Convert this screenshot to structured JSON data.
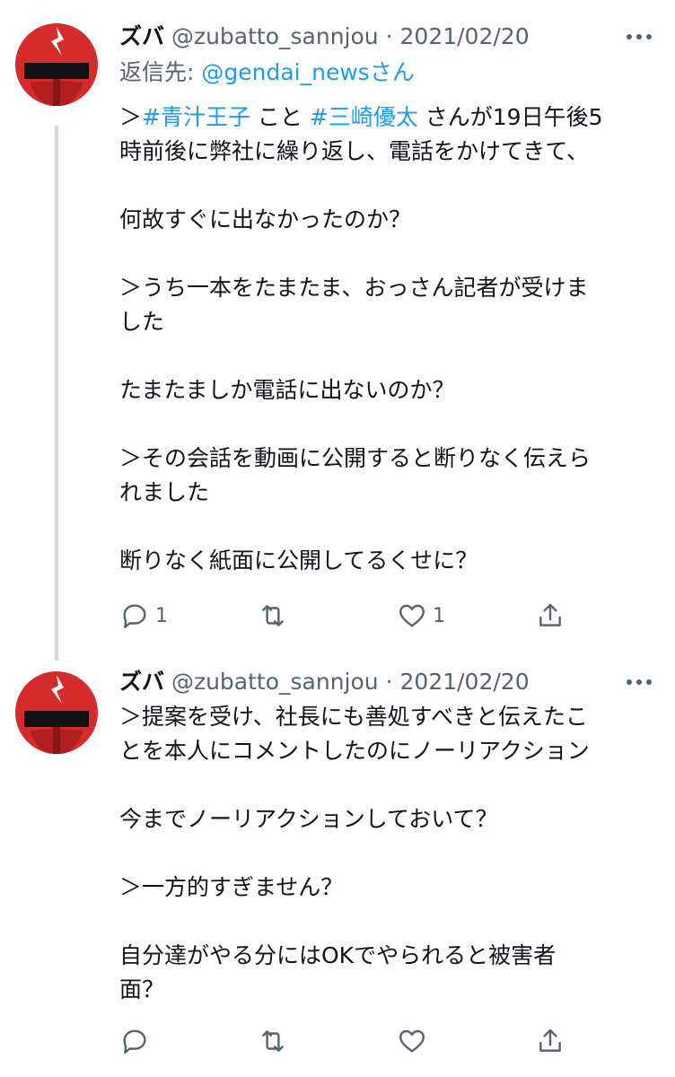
{
  "tweets": [
    {
      "author_name": "ズバ",
      "handle": "@zubatto_sannjou",
      "separator": "·",
      "date": "2021/02/20",
      "reply_label": "返信先: ",
      "reply_handle": "@gendai_news",
      "reply_suffix": "さん",
      "line1": {
        "prefix": "＞",
        "tag1": "#青汁王子",
        "mid": " こと ",
        "tag2": "#三崎優太",
        "suffix": " さんが19日午後5"
      },
      "lines": [
        "時前後に弊社に繰り返し、電話をかけてきて、",
        "",
        "何故すぐに出なかったのか？",
        "",
        "＞うち一本をたまたま、おっさん記者が受けま",
        "した",
        "",
        "たまたましか電話に出ないのか？",
        "",
        "＞その会話を動画に公開すると断りなく伝えら",
        "れました",
        "",
        "断りなく紙面に公開してるくせに？"
      ],
      "actions": {
        "reply_count": "1",
        "retweet_count": "",
        "like_count": "1"
      }
    },
    {
      "author_name": "ズバ",
      "handle": "@zubatto_sannjou",
      "separator": "·",
      "date": "2021/02/20",
      "lines": [
        "＞提案を受け、社長にも善処すべきと伝えたこ",
        "とを本人にコメントしたのにノーリアクション",
        "",
        "今までノーリアクションしておいて？",
        "",
        "＞一方的すぎません？",
        "",
        "自分達がやる分にはOKでやられると被害者",
        "面？"
      ],
      "actions": {
        "reply_count": "",
        "retweet_count": "",
        "like_count": ""
      }
    }
  ],
  "icons": {
    "avatar": "red-helmet-sunglasses-avatar",
    "more": "more-dots-icon",
    "reply": "reply-icon",
    "retweet": "retweet-icon",
    "like": "heart-icon",
    "share": "share-icon"
  },
  "colors": {
    "link": "#1d9bf0",
    "secondary_text": "#536471",
    "thread_line": "#cfd9de",
    "avatar_red": "#d62b2b"
  }
}
